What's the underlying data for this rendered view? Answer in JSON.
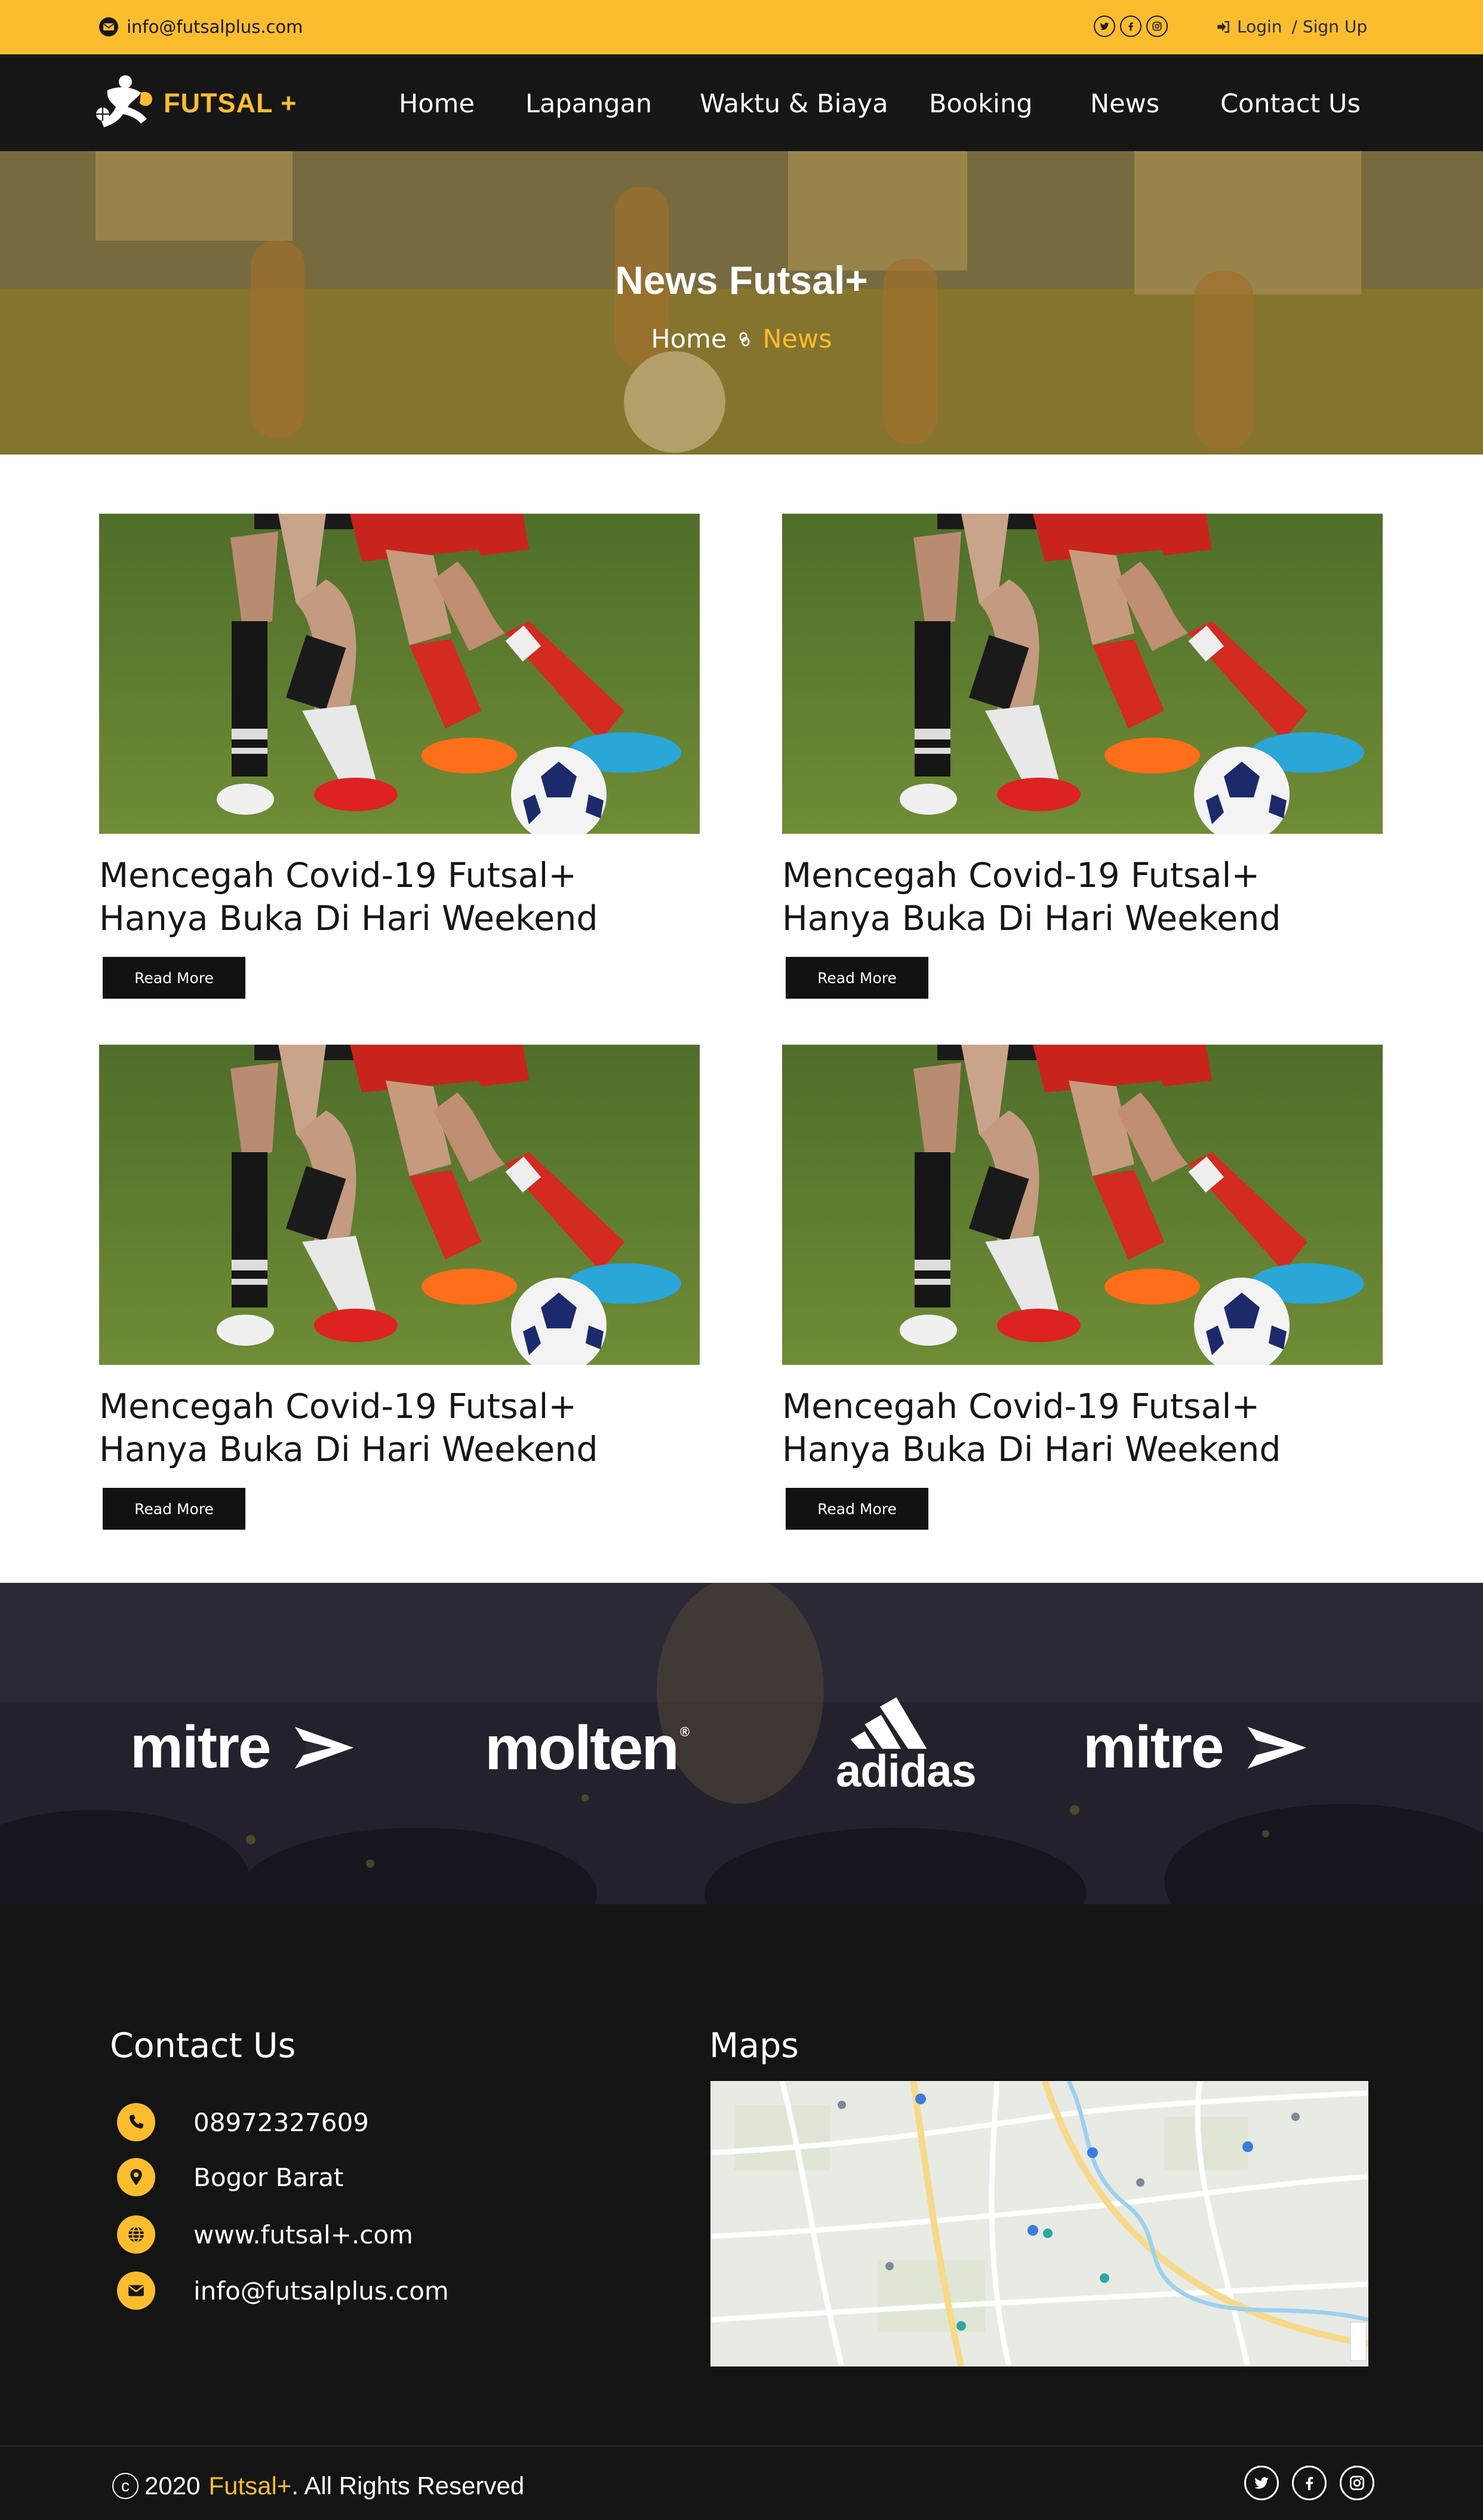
{
  "topbar": {
    "email": "info@futsalplus.com",
    "social_icons": [
      "twitter-icon",
      "facebook-icon",
      "instagram-icon"
    ],
    "login_label": "Login",
    "signup_label": "/ Sign Up"
  },
  "nav": {
    "logo_text": "FUTSAL +",
    "items": [
      "Home",
      "Lapangan",
      "Waktu & Biaya",
      "Booking",
      "News",
      "Contact Us"
    ]
  },
  "hero": {
    "title": "News Futsal+",
    "breadcrumb_home": "Home",
    "breadcrumb_current": "News"
  },
  "news": [
    {
      "title": "Mencegah Covid-19 Futsal+ Hanya Buka Di Hari Weekend",
      "button": "Read More"
    },
    {
      "title": "Mencegah Covid-19 Futsal+ Hanya Buka Di Hari Weekend",
      "button": "Read More"
    },
    {
      "title": "Mencegah Covid-19 Futsal+ Hanya Buka Di Hari Weekend",
      "button": "Read More"
    },
    {
      "title": "Mencegah Covid-19 Futsal+ Hanya Buka Di Hari Weekend",
      "button": "Read More"
    }
  ],
  "sponsors": [
    "mitre",
    "molten",
    "adidas",
    "mitre"
  ],
  "footer": {
    "contact_title": "Contact Us",
    "phone": "08972327609",
    "location": "Bogor Barat",
    "website": "www.futsal+.com",
    "email": "info@futsalplus.com",
    "maps_title": "Maps",
    "copyright_year": "2020",
    "copyright_brand": "Futsal+",
    "copyright_rest": ". All Rights Reserved"
  },
  "colors": {
    "accent": "#fbbd2e",
    "dark": "#161616"
  }
}
